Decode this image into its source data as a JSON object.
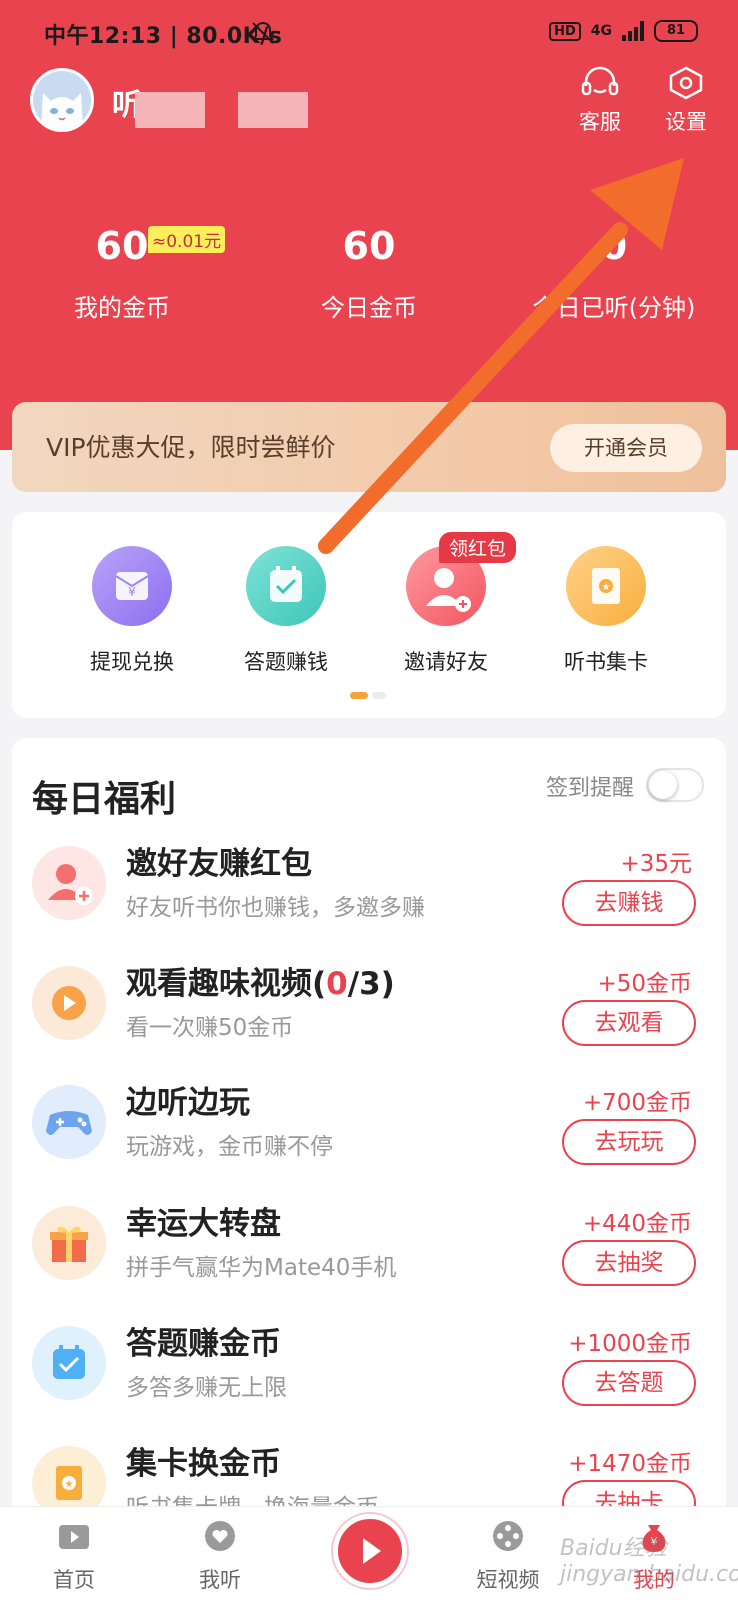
{
  "status_bar": {
    "time": "中午12:13 | 80.0K/s",
    "hd": "HD",
    "network": "4G",
    "battery": "81"
  },
  "profile": {
    "name_visible": "听"
  },
  "top_actions": {
    "service": "客服",
    "settings": "设置"
  },
  "stats": [
    {
      "value": "60",
      "label": "我的金币",
      "badge": "≈0.01元"
    },
    {
      "value": "60",
      "label": "今日金币"
    },
    {
      "value": "0",
      "label": "今日已听(分钟)"
    }
  ],
  "vip": {
    "text": "VIP优惠大促，限时尝鲜价",
    "button": "开通会员"
  },
  "quick_actions": [
    {
      "label": "提现兑换",
      "icon": "wallet-icon"
    },
    {
      "label": "答题赚钱",
      "icon": "calendar-check-icon"
    },
    {
      "label": "邀请好友",
      "icon": "invite-user-icon",
      "tag": "领红包"
    },
    {
      "label": "听书集卡",
      "icon": "card-star-icon"
    }
  ],
  "daily": {
    "title": "每日福利",
    "remind_label": "签到提醒",
    "remind_on": false,
    "tasks": [
      {
        "name": "邀好友赚红包",
        "desc": "好友听书你也赚钱，多邀多赚",
        "reward": "+35元",
        "button": "去赚钱",
        "icon": "invite-user-icon"
      },
      {
        "name_prefix": "观看趣味视频(",
        "name_count": "0",
        "name_suffix": "/3)",
        "desc": "看一次赚50金币",
        "reward": "+50金币",
        "button": "去观看",
        "icon": "play-video-icon"
      },
      {
        "name": "边听边玩",
        "desc": "玩游戏，金币赚不停",
        "reward": "+700金币",
        "button": "去玩玩",
        "icon": "gamepad-icon"
      },
      {
        "name": "幸运大转盘",
        "desc": "拼手气赢华为Mate40手机",
        "reward": "+440金币",
        "button": "去抽奖",
        "icon": "gift-icon"
      },
      {
        "name": "答题赚金币",
        "desc": "多答多赚无上限",
        "reward": "+1000金币",
        "button": "去答题",
        "icon": "calendar-check-icon"
      },
      {
        "name": "集卡换金币",
        "desc": "听书集卡牌，换海量金币",
        "reward": "+1470金币",
        "button": "去抽卡",
        "icon": "card-star-icon"
      }
    ]
  },
  "nav": [
    {
      "label": "首页",
      "icon": "home-icon"
    },
    {
      "label": "我听",
      "icon": "heart-icon"
    },
    {
      "label": "",
      "icon": "play-icon"
    },
    {
      "label": "短视频",
      "icon": "film-reel-icon"
    },
    {
      "label": "我的",
      "icon": "money-bag-icon",
      "active": true
    }
  ],
  "watermark": "Baidu经验 jingyan.baidu.com",
  "colors": {
    "brand_red": "#e8434e",
    "arrow_orange": "#f26c2c",
    "vip_gold": "#f3c8a6"
  }
}
